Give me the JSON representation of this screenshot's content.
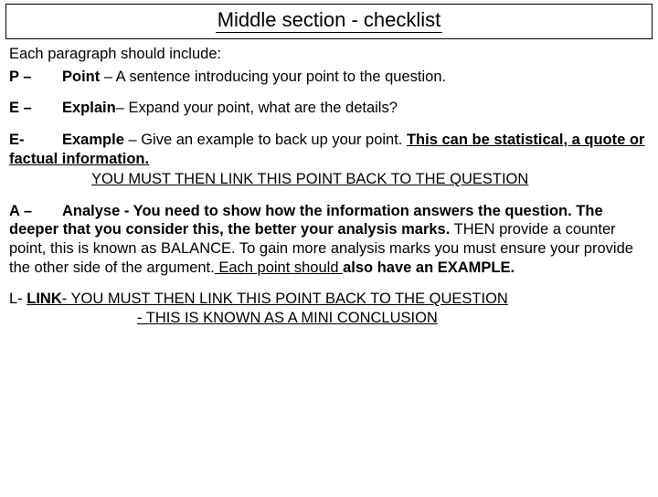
{
  "title": "Middle section - checklist",
  "intro": "Each paragraph should include:",
  "p": {
    "letter": "P –",
    "key": "Point",
    "rest": " – A sentence introducing your point to the question."
  },
  "e1": {
    "letter": "E –",
    "key": "Explain",
    "rest": "– Expand your point, what are the details?"
  },
  "e2": {
    "letter": "E-",
    "key": "Example",
    "mid": " – Give an example to back up your point. ",
    "tail": "This can be statistical, a quote or factual information.",
    "linkback": "YOU MUST THEN LINK THIS POINT BACK TO THE QUESTION"
  },
  "a": {
    "letter": "A –",
    "key": "Analyse",
    "part1": " - You need to show how the information answers the question. The deeper that you consider this, the better your analysis marks.",
    "part2": " THEN provide a counter point, this is known as BALANCE. To gain more analysis marks you must ensure your provide the other side of the argument.",
    "eachpoint": " Each point should ",
    "part3": " also have an EXAMPLE."
  },
  "l": {
    "prefix": "L- ",
    "key": "LINK",
    "rest1": "- YOU MUST THEN LINK THIS POINT BACK TO THE QUESTION",
    "rest2": "- THIS IS KNOWN AS A MINI CONCLUSION"
  }
}
